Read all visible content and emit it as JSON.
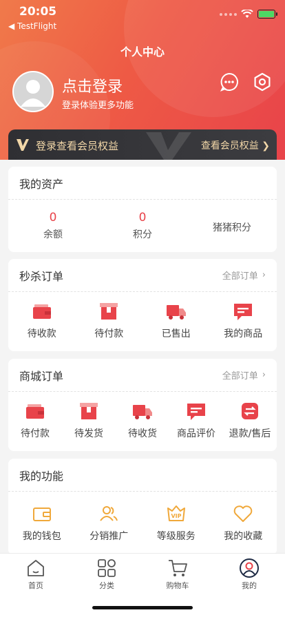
{
  "status_bar": {
    "time": "20:05",
    "back_app": "◀ TestFlight"
  },
  "header": {
    "title": "个人中心",
    "login_title": "点击登录",
    "login_subtitle": "登录体验更多功能"
  },
  "vip_bar": {
    "left_text": "登录查看会员权益",
    "right_text": "查看会员权益"
  },
  "assets": {
    "title": "我的资产",
    "items": [
      {
        "value": "0",
        "label": "余额"
      },
      {
        "value": "0",
        "label": "积分"
      },
      {
        "value": "",
        "label": "猪猪积分"
      }
    ]
  },
  "flash_orders": {
    "title": "秒杀订单",
    "more": "全部订单",
    "items": [
      {
        "label": "待收款",
        "icon": "wallet-icon"
      },
      {
        "label": "待付款",
        "icon": "box-icon"
      },
      {
        "label": "已售出",
        "icon": "truck-icon"
      },
      {
        "label": "我的商品",
        "icon": "comment-icon"
      }
    ]
  },
  "mall_orders": {
    "title": "商城订单",
    "more": "全部订单",
    "items": [
      {
        "label": "待付款",
        "icon": "wallet-icon"
      },
      {
        "label": "待发货",
        "icon": "box-icon"
      },
      {
        "label": "待收货",
        "icon": "truck-icon"
      },
      {
        "label": "商品评价",
        "icon": "comment-icon"
      },
      {
        "label": "退款/售后",
        "icon": "refund-icon"
      }
    ]
  },
  "functions": {
    "title": "我的功能",
    "items": [
      {
        "label": "我的钱包",
        "icon": "wallet-outline-icon"
      },
      {
        "label": "分销推广",
        "icon": "users-icon"
      },
      {
        "label": "等级服务",
        "icon": "vip-icon"
      },
      {
        "label": "我的收藏",
        "icon": "heart-icon"
      }
    ]
  },
  "tabbar": {
    "items": [
      {
        "label": "首页",
        "icon": "home-icon"
      },
      {
        "label": "分类",
        "icon": "category-icon"
      },
      {
        "label": "购物车",
        "icon": "cart-icon"
      },
      {
        "label": "我的",
        "icon": "profile-icon",
        "active": true
      }
    ]
  },
  "colors": {
    "accent": "#e8434a",
    "gold": "#f0a83a",
    "vip_text": "#f2d7a8"
  }
}
